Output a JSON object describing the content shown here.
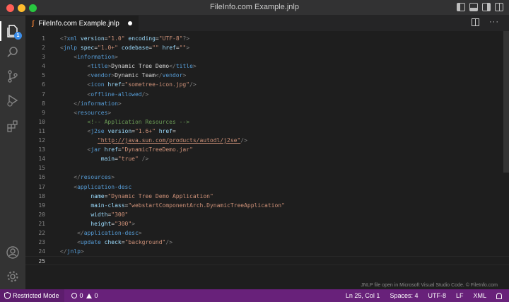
{
  "window": {
    "title": "FileInfo.com Example.jnlp"
  },
  "activity": {
    "explorer_badge": "1"
  },
  "tab": {
    "file_icon": "ʃ",
    "label": "FileInfo.com Example.jnlp",
    "more": "···"
  },
  "editor": {
    "lines": [
      {
        "n": "1",
        "parts": [
          [
            "pun",
            "<?"
          ],
          [
            "tag",
            "xml"
          ],
          [
            "plain",
            " "
          ],
          [
            "attr",
            "version"
          ],
          [
            "plain",
            "="
          ],
          [
            "str",
            "\"1.0\""
          ],
          [
            "plain",
            " "
          ],
          [
            "attr",
            "encoding"
          ],
          [
            "plain",
            "="
          ],
          [
            "str",
            "\"UTF-8\""
          ],
          [
            "pun",
            "?>"
          ]
        ]
      },
      {
        "n": "2",
        "parts": [
          [
            "pun",
            "<"
          ],
          [
            "tag",
            "jnlp"
          ],
          [
            "plain",
            " "
          ],
          [
            "attr",
            "spec"
          ],
          [
            "plain",
            "="
          ],
          [
            "str",
            "\"1.0+\""
          ],
          [
            "plain",
            " "
          ],
          [
            "attr",
            "codebase"
          ],
          [
            "plain",
            "="
          ],
          [
            "str",
            "\"\""
          ],
          [
            "plain",
            " "
          ],
          [
            "attr",
            "href"
          ],
          [
            "plain",
            "="
          ],
          [
            "str",
            "\"\""
          ],
          [
            "pun",
            ">"
          ]
        ]
      },
      {
        "n": "3",
        "parts": [
          [
            "plain",
            "    "
          ],
          [
            "pun",
            "<"
          ],
          [
            "tag",
            "information"
          ],
          [
            "pun",
            ">"
          ]
        ]
      },
      {
        "n": "4",
        "parts": [
          [
            "plain",
            "        "
          ],
          [
            "pun",
            "<"
          ],
          [
            "tag",
            "title"
          ],
          [
            "pun",
            ">"
          ],
          [
            "plain",
            "Dynamic Tree Demo"
          ],
          [
            "pun",
            "</"
          ],
          [
            "tag",
            "title"
          ],
          [
            "pun",
            ">"
          ]
        ]
      },
      {
        "n": "5",
        "parts": [
          [
            "plain",
            "        "
          ],
          [
            "pun",
            "<"
          ],
          [
            "tag",
            "vendor"
          ],
          [
            "pun",
            ">"
          ],
          [
            "plain",
            "Dynamic Team"
          ],
          [
            "pun",
            "</"
          ],
          [
            "tag",
            "vendor"
          ],
          [
            "pun",
            ">"
          ]
        ]
      },
      {
        "n": "6",
        "parts": [
          [
            "plain",
            "        "
          ],
          [
            "pun",
            "<"
          ],
          [
            "tag",
            "icon"
          ],
          [
            "plain",
            " "
          ],
          [
            "attr",
            "href"
          ],
          [
            "plain",
            "="
          ],
          [
            "str",
            "\"sometree-icon.jpg\""
          ],
          [
            "pun",
            "/>"
          ]
        ]
      },
      {
        "n": "7",
        "parts": [
          [
            "plain",
            "        "
          ],
          [
            "pun",
            "<"
          ],
          [
            "tag",
            "offline-allowed"
          ],
          [
            "pun",
            "/>"
          ]
        ]
      },
      {
        "n": "8",
        "parts": [
          [
            "plain",
            "    "
          ],
          [
            "pun",
            "</"
          ],
          [
            "tag",
            "information"
          ],
          [
            "pun",
            ">"
          ]
        ]
      },
      {
        "n": "9",
        "parts": [
          [
            "plain",
            "    "
          ],
          [
            "pun",
            "<"
          ],
          [
            "tag",
            "resources"
          ],
          [
            "pun",
            ">"
          ]
        ]
      },
      {
        "n": "10",
        "parts": [
          [
            "plain",
            "        "
          ],
          [
            "com",
            "<!-- Application Resources -->"
          ]
        ]
      },
      {
        "n": "11",
        "parts": [
          [
            "plain",
            "        "
          ],
          [
            "pun",
            "<"
          ],
          [
            "tag",
            "j2se"
          ],
          [
            "plain",
            " "
          ],
          [
            "attr",
            "version"
          ],
          [
            "plain",
            "="
          ],
          [
            "str",
            "\"1.6+\""
          ],
          [
            "plain",
            " "
          ],
          [
            "attr",
            "href"
          ],
          [
            "plain",
            "="
          ]
        ]
      },
      {
        "n": "12",
        "parts": [
          [
            "plain",
            "           "
          ],
          [
            "url",
            "\"http://java.sun.com/products/autodl/j2se\""
          ],
          [
            "pun",
            "/>"
          ]
        ]
      },
      {
        "n": "13",
        "parts": [
          [
            "plain",
            "        "
          ],
          [
            "pun",
            "<"
          ],
          [
            "tag",
            "jar"
          ],
          [
            "plain",
            " "
          ],
          [
            "attr",
            "href"
          ],
          [
            "plain",
            "="
          ],
          [
            "str",
            "\"DynamicTreeDemo.jar\""
          ]
        ]
      },
      {
        "n": "14",
        "parts": [
          [
            "plain",
            "            "
          ],
          [
            "attr",
            "main"
          ],
          [
            "plain",
            "="
          ],
          [
            "str",
            "\"true\""
          ],
          [
            "plain",
            " "
          ],
          [
            "pun",
            "/>"
          ]
        ]
      },
      {
        "n": "15",
        "parts": []
      },
      {
        "n": "16",
        "parts": [
          [
            "plain",
            "    "
          ],
          [
            "pun",
            "</"
          ],
          [
            "tag",
            "resources"
          ],
          [
            "pun",
            ">"
          ]
        ]
      },
      {
        "n": "17",
        "parts": [
          [
            "plain",
            "    "
          ],
          [
            "pun",
            "<"
          ],
          [
            "tag",
            "application-desc"
          ]
        ]
      },
      {
        "n": "18",
        "parts": [
          [
            "plain",
            "         "
          ],
          [
            "attr",
            "name"
          ],
          [
            "plain",
            "="
          ],
          [
            "str",
            "\"Dynamic Tree Demo Application\""
          ]
        ]
      },
      {
        "n": "19",
        "parts": [
          [
            "plain",
            "         "
          ],
          [
            "attr",
            "main-class"
          ],
          [
            "plain",
            "="
          ],
          [
            "str",
            "\"webstartComponentArch.DynamicTreeApplication\""
          ]
        ]
      },
      {
        "n": "20",
        "parts": [
          [
            "plain",
            "         "
          ],
          [
            "attr",
            "width"
          ],
          [
            "plain",
            "="
          ],
          [
            "str",
            "\"300\""
          ]
        ]
      },
      {
        "n": "21",
        "parts": [
          [
            "plain",
            "         "
          ],
          [
            "attr",
            "height"
          ],
          [
            "plain",
            "="
          ],
          [
            "str",
            "\"300\""
          ],
          [
            "pun",
            ">"
          ]
        ]
      },
      {
        "n": "22",
        "parts": [
          [
            "plain",
            "     "
          ],
          [
            "pun",
            "</"
          ],
          [
            "tag",
            "application-desc"
          ],
          [
            "pun",
            ">"
          ]
        ]
      },
      {
        "n": "23",
        "parts": [
          [
            "plain",
            "     "
          ],
          [
            "pun",
            "<"
          ],
          [
            "tag",
            "update"
          ],
          [
            "plain",
            " "
          ],
          [
            "attr",
            "check"
          ],
          [
            "plain",
            "="
          ],
          [
            "str",
            "\"background\""
          ],
          [
            "pun",
            "/>"
          ]
        ]
      },
      {
        "n": "24",
        "parts": [
          [
            "pun",
            "</"
          ],
          [
            "tag",
            "jnlp"
          ],
          [
            "pun",
            ">"
          ]
        ]
      },
      {
        "n": "25",
        "parts": [],
        "current": true
      }
    ],
    "watermark": "JNLP file open in Microsoft Visual Studio Code. © FileInfo.com"
  },
  "status": {
    "restricted": "Restricted Mode",
    "errors": "0",
    "warnings": "0",
    "position": "Ln 25, Col 1",
    "spaces": "Spaces: 4",
    "encoding": "UTF-8",
    "eol": "LF",
    "language": "XML"
  }
}
